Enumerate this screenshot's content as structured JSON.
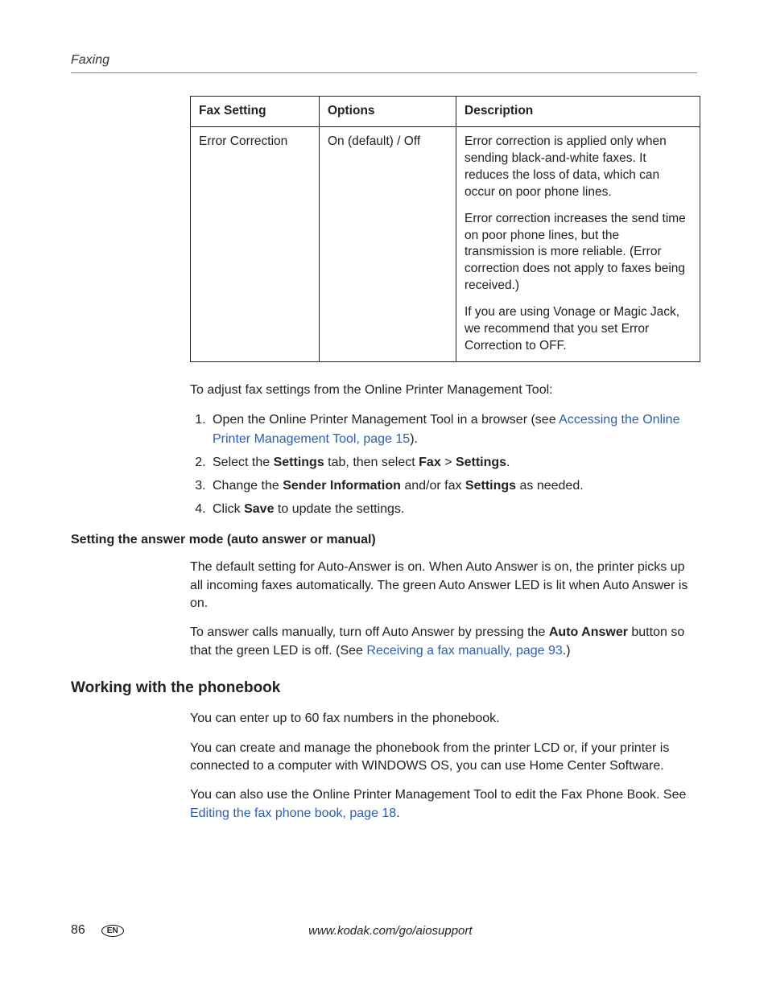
{
  "header": {
    "section": "Faxing"
  },
  "table": {
    "headers": {
      "setting": "Fax Setting",
      "options": "Options",
      "description": "Description"
    },
    "row": {
      "setting": "Error Correction",
      "options": "On (default) / Off",
      "desc1": "Error correction is applied only when sending black-and-white faxes. It reduces the loss of data, which can occur on poor phone lines.",
      "desc2": "Error correction increases the send time on poor phone lines, but the transmission is more reliable. (Error correction does not apply to faxes being received.)",
      "desc3": "If you are using Vonage or Magic Jack, we recommend that you set Error Correction to OFF."
    }
  },
  "intro": "To adjust fax settings from the Online Printer Management Tool:",
  "steps": {
    "s1a": "Open the Online Printer Management Tool in a browser (see ",
    "s1link": "Accessing the Online Printer Management Tool, page 15",
    "s1b": ").",
    "s2a": "Select the ",
    "s2b": "Settings",
    "s2c": " tab, then select ",
    "s2d": "Fax",
    "s2e": " > ",
    "s2f": "Settings",
    "s2g": ".",
    "s3a": "Change the ",
    "s3b": "Sender Information",
    "s3c": " and/or fax ",
    "s3d": "Settings",
    "s3e": " as needed.",
    "s4a": "Click ",
    "s4b": "Save",
    "s4c": " to update the settings."
  },
  "answer_mode": {
    "heading": "Setting the answer mode (auto answer or manual)",
    "p1": "The default setting for Auto-Answer is on. When Auto Answer is on, the printer picks up all incoming faxes automatically. The green Auto Answer LED is lit when Auto Answer is on.",
    "p2a": "To answer calls manually, turn off Auto Answer by pressing the ",
    "p2b": "Auto Answer",
    "p2c": " button so that the green LED is off. (See ",
    "p2link": "Receiving a fax manually, page 93",
    "p2d": ".)"
  },
  "phonebook": {
    "heading": "Working with the phonebook",
    "p1": "You can enter up to 60 fax numbers in the phonebook.",
    "p2": "You can create and manage the phonebook from the printer LCD or, if your printer is connected to a computer with WINDOWS OS, you can use Home Center Software.",
    "p3a": "You can also use the Online Printer Management Tool to edit the Fax Phone Book. See ",
    "p3link": "Editing the fax phone book, page 18",
    "p3b": "."
  },
  "footer": {
    "page": "86",
    "lang": "EN",
    "url": "www.kodak.com/go/aiosupport"
  }
}
